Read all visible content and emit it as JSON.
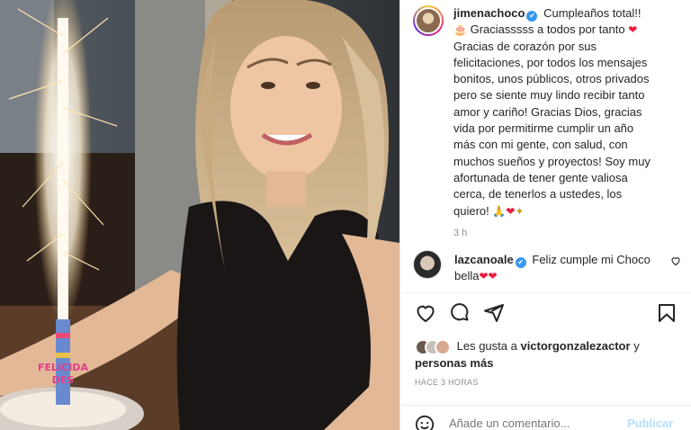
{
  "post": {
    "username": "jimenachoco",
    "caption_lines": [
      "Cumpleaños total!!",
      "Graciasssss a todos por tanto",
      "Gracias de corazón por sus",
      "felicitaciones, por todos los mensajes",
      "bonitos, unos públicos, otros privados",
      "pero se siente muy lindo recibir tanto",
      "amor y cariño! Gracias Dios, gracias",
      "vida por permitirme cumplir un año",
      "más con mi gente, con salud, con",
      "muchos sueños y proyectos! Soy muy",
      "afortunada de tener gente valiosa",
      "cerca, de tenerlos a ustedes, los",
      "quiero!"
    ],
    "time": "3 h",
    "cake_letters": "FELICIDADES"
  },
  "comment": {
    "username": "lazcanoale",
    "text_line1": "Feliz cumple mi Choco",
    "text_line2": "bella"
  },
  "likes": {
    "prefix": "Les gusta a",
    "user": "victorgonzalezactor",
    "conj": "y",
    "others": "personas más"
  },
  "posted_ago": "HACE 3 HORAS",
  "add_comment": {
    "placeholder": "Añade un comentario...",
    "publish": "Publicar"
  },
  "icons": [
    "verified-icon",
    "cake-emoji",
    "heart-emoji",
    "pray-emoji",
    "bird-emoji",
    "heart-outline-icon",
    "comment-icon",
    "share-icon",
    "bookmark-icon",
    "smile-icon"
  ],
  "colors": {
    "verified": "#3897f0",
    "heart": "#ed1c3c",
    "publish": "#b2dffc",
    "muted": "#8e8e8e"
  }
}
